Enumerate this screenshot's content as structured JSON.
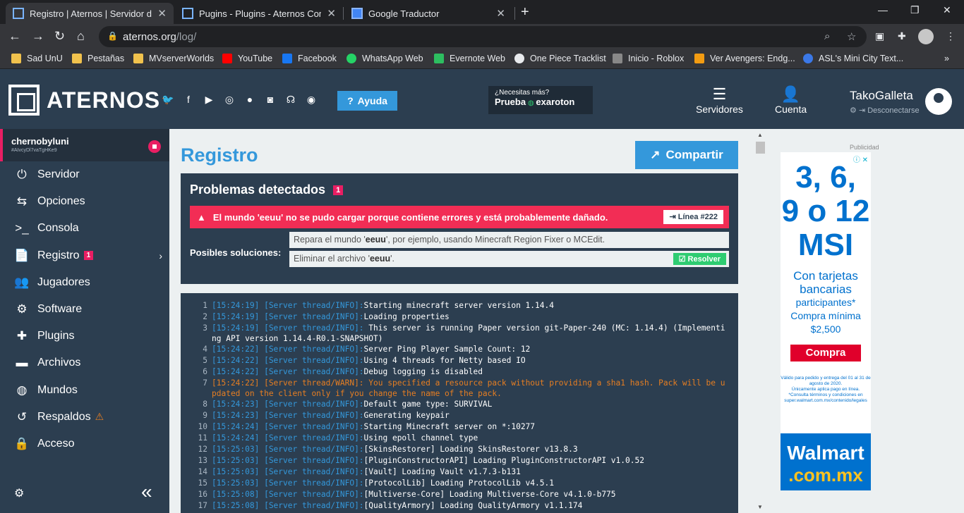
{
  "browser": {
    "tabs": [
      {
        "title": "Registro | Aternos | Servidor de M",
        "active": true
      },
      {
        "title": "Pugins - Plugins - Aternos Comm",
        "active": false
      },
      {
        "title": "Google Traductor",
        "active": false
      }
    ],
    "url_host": "aternos.org",
    "url_path": "/log/",
    "bookmarks": [
      "Sad UnU",
      "Pestañas",
      "MVserverWorlds",
      "YouTube",
      "Facebook",
      "WhatsApp Web",
      "Evernote Web",
      "One Piece Tracklist",
      "Inicio - Roblox",
      "Ver Avengers: Endg...",
      "ASL's Mini City Text..."
    ]
  },
  "header": {
    "logo": "ATERNOS",
    "help": "Ayuda",
    "promo_q": "¿Necesitas más?",
    "promo_try": "Prueba",
    "promo_brand": "exaroton",
    "servers": "Servidores",
    "account": "Cuenta",
    "username": "TakoGalleta",
    "logout": "Desconectarse"
  },
  "sidebar": {
    "server_name": "chernobyluni",
    "server_id": "#AIvcyDl7vaTgHKe9",
    "items": [
      {
        "label": "Servidor",
        "icon": "power-icon"
      },
      {
        "label": "Opciones",
        "icon": "sliders-icon"
      },
      {
        "label": "Consola",
        "icon": "terminal-icon"
      },
      {
        "label": "Registro",
        "icon": "file-icon",
        "badge": "1"
      },
      {
        "label": "Jugadores",
        "icon": "users-icon"
      },
      {
        "label": "Software",
        "icon": "gears-icon"
      },
      {
        "label": "Plugins",
        "icon": "puzzle-icon"
      },
      {
        "label": "Archivos",
        "icon": "folder-icon"
      },
      {
        "label": "Mundos",
        "icon": "globe-icon"
      },
      {
        "label": "Respaldos",
        "icon": "history-icon"
      },
      {
        "label": "Acceso",
        "icon": "user-lock-icon"
      }
    ]
  },
  "main": {
    "title": "Registro",
    "share": "Compartir",
    "problems_title": "Problemas detectados",
    "problems_count": "1",
    "error_msg": "El mundo 'eeuu' no se pudo cargar porque contiene errores y está probablemente dañado.",
    "line_ref": "Línea #222",
    "solutions_label": "Posibles soluciones:",
    "solution1_pre": "Repara el mundo '",
    "solution1_world": "eeuu",
    "solution1_post": "', por ejemplo, usando Minecraft Region Fixer o MCEdit.",
    "solution2_pre": "Eliminar el archivo '",
    "solution2_world": "eeuu",
    "solution2_post": "'.",
    "resolve": "Resolver"
  },
  "log": [
    {
      "n": "1",
      "ts": "[15:24:19] [Server thread/INFO]:",
      "msg": "Starting minecraft server version 1.14.4"
    },
    {
      "n": "2",
      "ts": "[15:24:19] [Server thread/INFO]:",
      "msg": "Loading properties"
    },
    {
      "n": "3",
      "ts": "[15:24:19] [Server thread/INFO]:",
      "msg": "This server is running Paper version git-Paper-240 (MC: 1.14.4) (Implementing API version 1.14.4-R0.1-SNAPSHOT)",
      "wrap": true
    },
    {
      "n": "4",
      "ts": "[15:24:22] [Server thread/INFO]:",
      "msg": "Server Ping Player Sample Count: 12"
    },
    {
      "n": "5",
      "ts": "[15:24:22] [Server thread/INFO]:",
      "msg": "Using 4 threads for Netty based IO"
    },
    {
      "n": "6",
      "ts": "[15:24:22] [Server thread/INFO]:",
      "msg": "Debug logging is disabled"
    },
    {
      "n": "7",
      "ts": "[15:24:22] [Server thread/WARN]:",
      "msg": "You specified a resource pack without providing a sha1 hash. Pack will be updated on the client only if you change the name of the pack.",
      "wrap": true,
      "warn": true
    },
    {
      "n": "8",
      "ts": "[15:24:23] [Server thread/INFO]:",
      "msg": "Default game type: SURVIVAL"
    },
    {
      "n": "9",
      "ts": "[15:24:23] [Server thread/INFO]:",
      "msg": "Generating keypair"
    },
    {
      "n": "10",
      "ts": "[15:24:24] [Server thread/INFO]:",
      "msg": "Starting Minecraft server on *:10277"
    },
    {
      "n": "11",
      "ts": "[15:24:24] [Server thread/INFO]:",
      "msg": "Using epoll channel type"
    },
    {
      "n": "12",
      "ts": "[15:25:03] [Server thread/INFO]:",
      "msg": "[SkinsRestorer] Loading SkinsRestorer v13.8.3"
    },
    {
      "n": "13",
      "ts": "[15:25:03] [Server thread/INFO]:",
      "msg": "[PluginConstructorAPI] Loading PluginConstructorAPI v1.0.52"
    },
    {
      "n": "14",
      "ts": "[15:25:03] [Server thread/INFO]:",
      "msg": "[Vault] Loading Vault v1.7.3-b131"
    },
    {
      "n": "15",
      "ts": "[15:25:03] [Server thread/INFO]:",
      "msg": "[ProtocolLib] Loading ProtocolLib v4.5.1"
    },
    {
      "n": "16",
      "ts": "[15:25:08] [Server thread/INFO]:",
      "msg": "[Multiverse-Core] Loading Multiverse-Core v4.1.0-b775"
    },
    {
      "n": "17",
      "ts": "[15:25:08] [Server thread/INFO]:",
      "msg": "[QualityArmory] Loading QualityArmory v1.1.174"
    }
  ],
  "ad": {
    "label": "Publicidad",
    "line1": "3, 6,",
    "line2": "9 o 12",
    "line3": "MSI",
    "line4": "Con tarjetas bancarias",
    "line5": "participantes*",
    "line6": "Compra mínima",
    "line7": "$2,500",
    "cta": "Compra",
    "fine1": "Válido para pedido y entrega del 01 al 31 de agosto de 2020.",
    "fine2": "Únicamente aplica pago en línea.",
    "fine3": "*Consulta términos y condiciones en super.walmart.com.mx/contenido/legales",
    "brand1": "Walmart",
    "brand2": ".com.mx"
  }
}
